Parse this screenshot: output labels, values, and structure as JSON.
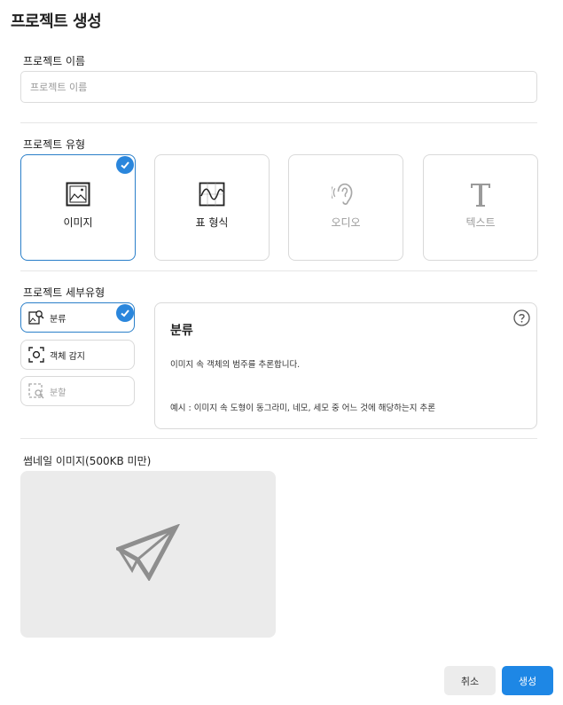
{
  "page": {
    "title": "프로젝트 생성"
  },
  "project_name": {
    "label": "프로젝트 이름",
    "placeholder": "프로젝트 이름",
    "value": ""
  },
  "project_type": {
    "label": "프로젝트 유형",
    "options": [
      {
        "label": "이미지",
        "icon": "image-icon",
        "selected": true,
        "enabled": true
      },
      {
        "label": "표 형식",
        "icon": "tabular-chart-icon",
        "selected": false,
        "enabled": true
      },
      {
        "label": "오디오",
        "icon": "ear-icon",
        "selected": false,
        "enabled": false
      },
      {
        "label": "텍스트",
        "icon": "text-t-icon",
        "selected": false,
        "enabled": false
      }
    ]
  },
  "project_subtype": {
    "label": "프로젝트 세부유형",
    "options": [
      {
        "label": "분류",
        "icon": "image-search-icon",
        "selected": true,
        "enabled": true
      },
      {
        "label": "객체 감지",
        "icon": "object-detect-icon",
        "selected": false,
        "enabled": true
      },
      {
        "label": "분할",
        "icon": "segment-icon",
        "selected": false,
        "enabled": false
      }
    ],
    "description": {
      "title": "분류",
      "text": "이미지 속 객체의 범주를 추론합니다.",
      "example": "예시 : 이미지 속 도형이 동그라미, 네모, 세모 중 어느 것에 해당하는지 추론"
    }
  },
  "thumbnail": {
    "label": "썸네일 이미지(500KB 미만)"
  },
  "actions": {
    "cancel": "취소",
    "create": "생성"
  },
  "colors": {
    "accent": "#1e87e5",
    "selected_border": "#2a7fc9"
  }
}
